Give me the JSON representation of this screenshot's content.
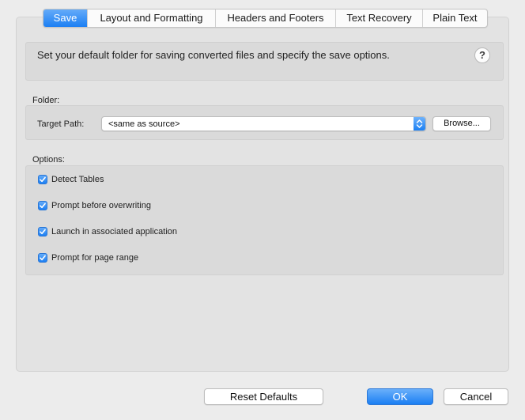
{
  "tabs": [
    {
      "label": "Save",
      "active": true
    },
    {
      "label": "Layout and Formatting",
      "active": false
    },
    {
      "label": "Headers and Footers",
      "active": false
    },
    {
      "label": "Text Recovery",
      "active": false
    },
    {
      "label": "Plain Text",
      "active": false
    }
  ],
  "description": {
    "text": "Set your default folder for saving converted files and specify the save options.",
    "help_label": "?"
  },
  "folder": {
    "section_label": "Folder:",
    "target_label": "Target Path:",
    "target_value": "<same as source>",
    "browse_label": "Browse..."
  },
  "options": {
    "section_label": "Options:",
    "items": [
      {
        "label": "Detect Tables",
        "checked": true
      },
      {
        "label": "Prompt before overwriting",
        "checked": true
      },
      {
        "label": "Launch in associated application",
        "checked": true
      },
      {
        "label": "Prompt for page range",
        "checked": true
      }
    ]
  },
  "buttons": {
    "reset_label": "Reset Defaults",
    "ok_label": "OK",
    "cancel_label": "Cancel"
  },
  "colors": {
    "accent": "#1c7ff3",
    "background": "#ececec"
  }
}
